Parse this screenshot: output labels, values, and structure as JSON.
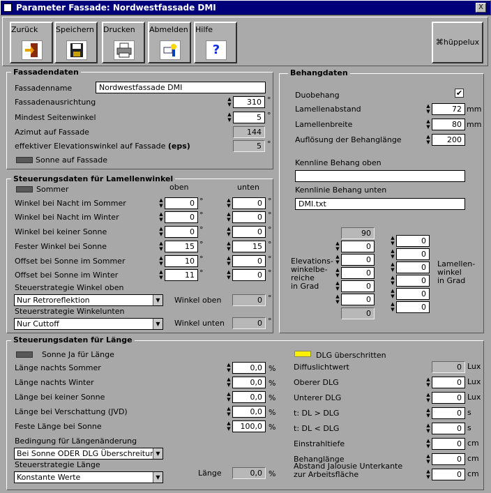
{
  "window": {
    "title": "Parameter Fassade: Nordwestfassade DMI",
    "close": "X"
  },
  "toolbar": {
    "back": "Zurück",
    "save": "Speichern",
    "print": "Drucken",
    "logout": "Abmelden",
    "help": "Hilfe",
    "huppelux": "hüppelux",
    "help_glyph": "?"
  },
  "fassadendaten": {
    "title": "Fassadendaten",
    "name_label": "Fassadenname",
    "name_value": "Nordwestfassade DMI",
    "ausrichtung_label": "Fassadenausrichtung",
    "ausrichtung_value": "310",
    "seitenwinkel_label": "Mindest Seitenwinkel",
    "seitenwinkel_value": "5",
    "azimut_label": "Azimut auf Fassade",
    "azimut_value": "144",
    "elev_label": "effektiver Elevationswinkel auf Fassade",
    "elev_label_bold": "(eps)",
    "elev_value": "5",
    "sonne_label": "Sonne auf Fassade",
    "degree": "°"
  },
  "lamellen": {
    "title": "Steuerungsdaten für Lamellenwinkel",
    "sommer": "Sommer",
    "oben": "oben",
    "unten": "unten",
    "rows": [
      {
        "label": "Winkel bei Nacht im Sommer",
        "oben": "0",
        "unten": "0"
      },
      {
        "label": "Winkel bei Nacht im Winter",
        "oben": "0",
        "unten": "0"
      },
      {
        "label": "Winkel bei keiner Sonne",
        "oben": "0",
        "unten": "0"
      },
      {
        "label": "Fester Winkel bei Sonne",
        "oben": "15",
        "unten": "15"
      },
      {
        "label": "Offset bei Sonne im Sommer",
        "oben": "10",
        "unten": "0"
      },
      {
        "label": "Offset bei Sonne im Winter",
        "oben": "11",
        "unten": "0"
      }
    ],
    "strat_oben_label": "Steuerstrategie Winkel oben",
    "strat_oben_value": "Nur Retroreflektion",
    "winkel_oben_label": "Winkel oben",
    "winkel_oben_value": "0",
    "strat_unten_label": "Steuerstrategie Winkelunten",
    "strat_unten_value": "Nur Cuttoff",
    "winkel_unten_label": "Winkel  unten",
    "winkel_unten_value": "0"
  },
  "behang": {
    "title": "Behangdaten",
    "duo_label": "Duobehang",
    "duo_checked": "✔",
    "abstand_label": "Lamellenabstand",
    "abstand_value": "72",
    "breite_label": "Lamellenbreite",
    "breite_value": "80",
    "mm": "mm",
    "aufl_label": "Auflösung der Behanglänge",
    "aufl_value": "200",
    "oben_label": "Kennline Behang oben",
    "oben_value": "",
    "unten_label": "Kennlinie Behang unten",
    "unten_value": "DMI.txt",
    "elev_label": "Elevations-\nwinkelbe-\nreiche\nin Grad",
    "elev_top": "90",
    "elev_values": [
      "0",
      "0",
      "0",
      "0",
      "0"
    ],
    "elev_bottom": "0",
    "lam_label": "Lamellen-\nwinkel\nin Grad",
    "lam_values": [
      "0",
      "0",
      "0",
      "0",
      "0",
      "0"
    ]
  },
  "laenge": {
    "title": "Steuerungsdaten für Länge",
    "sonne_label": "Sonne Ja für Länge",
    "pct": "%",
    "rows": [
      {
        "label": "Länge nachts Sommer",
        "value": "0,0"
      },
      {
        "label": "Länge nachts Winter",
        "value": "0,0"
      },
      {
        "label": "Länge bei keiner Sonne",
        "value": "0,0"
      },
      {
        "label": "Länge bei Verschattung (JVD)",
        "value": "0,0"
      },
      {
        "label": "Feste Länge bei Sonne",
        "value": "100,0"
      }
    ],
    "bed_label": "Bedingung für Längenänderung",
    "bed_value": "Bei Sonne ODER DLG Überschreitung",
    "strat_label": "Steuerstrategie Länge",
    "strat_value": "Konstante Werte",
    "laenge_label": "Länge",
    "laenge_value": "0,0",
    "dlg_label": "DLG überschritten",
    "right_rows": [
      {
        "label": "Diffuslichtwert",
        "value": "0",
        "unit": "Lux"
      },
      {
        "label": "Oberer DLG",
        "value": "0",
        "unit": "Lux"
      },
      {
        "label": "Unterer DLG",
        "value": "0",
        "unit": "Lux"
      },
      {
        "label": "t: DL > DLG",
        "value": "0",
        "unit": "s"
      },
      {
        "label": "t: DL < DLG",
        "value": "0",
        "unit": "s"
      },
      {
        "label": "Einstrahltiefe",
        "value": "0",
        "unit": "cm"
      },
      {
        "label": "Behanglänge",
        "value": "0",
        "unit": "cm"
      },
      {
        "label": "Abstand Jalousie Unterkante\nzur Arbeitsfläche",
        "value": "0",
        "unit": "cm"
      }
    ]
  },
  "icons": [
    "door-exit-icon",
    "floppy-disk-icon",
    "printer-icon",
    "logout-hand-icon",
    "help-icon"
  ]
}
